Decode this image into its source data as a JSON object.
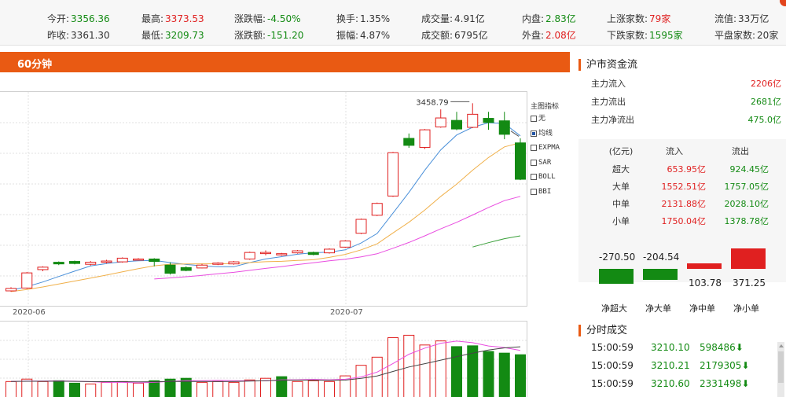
{
  "quote": {
    "row1": [
      {
        "label": "今开:",
        "value": "3356.36",
        "color": "#138a13"
      },
      {
        "label": "最高:",
        "value": "3373.53",
        "color": "#e02020"
      },
      {
        "label": "涨跌幅:",
        "value": "-4.50%",
        "color": "#138a13"
      },
      {
        "label": "换手:",
        "value": "1.35%",
        "color": "#333333"
      },
      {
        "label": "成交量:",
        "value": "4.91亿",
        "color": "#333333"
      },
      {
        "label": "内盘:",
        "value": "2.83亿",
        "color": "#138a13"
      },
      {
        "label": "上涨家数:",
        "value": "79家",
        "color": "#e02020"
      },
      {
        "label": "流值:",
        "value": "33万亿",
        "color": "#333333"
      }
    ],
    "row2": [
      {
        "label": "昨收:",
        "value": "3361.30",
        "color": "#333333"
      },
      {
        "label": "最低:",
        "value": "3209.73",
        "color": "#138a13"
      },
      {
        "label": "涨跌额:",
        "value": "-151.20",
        "color": "#138a13"
      },
      {
        "label": "振幅:",
        "value": "4.87%",
        "color": "#333333"
      },
      {
        "label": "成交额:",
        "value": "6795亿",
        "color": "#333333"
      },
      {
        "label": "外盘:",
        "value": "2.08亿",
        "color": "#e02020"
      },
      {
        "label": "下跌家数:",
        "value": "1595家",
        "color": "#138a13"
      },
      {
        "label": "平盘家数:",
        "value": "20家",
        "color": "#333333"
      }
    ]
  },
  "chart": {
    "period_tab": "60分钟",
    "x_labels": [
      "2020-06",
      "2020-07"
    ],
    "peak_label": "3458.79"
  },
  "indicators": {
    "title": "主图指标",
    "options": [
      {
        "label": "无",
        "checked": false
      },
      {
        "label": "均线",
        "checked": true
      },
      {
        "label": "EXPMA",
        "checked": false
      },
      {
        "label": "SAR",
        "checked": false
      },
      {
        "label": "BOLL",
        "checked": false
      },
      {
        "label": "BBI",
        "checked": false
      }
    ]
  },
  "fund_flow": {
    "title": "沪市资金流",
    "rows": [
      {
        "label": "主力流入",
        "value": "2206亿",
        "color": "#e02020"
      },
      {
        "label": "主力流出",
        "value": "2681亿",
        "color": "#138a13"
      },
      {
        "label": "主力净流出",
        "value": "475.0亿",
        "color": "#138a13"
      }
    ],
    "table": {
      "headers": [
        "(亿元)",
        "流入",
        "流出"
      ],
      "rows": [
        [
          "超大",
          "653.95亿",
          "924.45亿"
        ],
        [
          "大单",
          "1552.51亿",
          "1757.05亿"
        ],
        [
          "中单",
          "2131.88亿",
          "2028.10亿"
        ],
        [
          "小单",
          "1750.04亿",
          "1378.78亿"
        ]
      ]
    },
    "net": [
      {
        "label": "净超大",
        "value": "-270.50",
        "amount": -270.5
      },
      {
        "label": "净大单",
        "value": "-204.54",
        "amount": -204.54
      },
      {
        "label": "净中单",
        "value": "103.78",
        "amount": 103.78
      },
      {
        "label": "净小单",
        "value": "371.25",
        "amount": 371.25
      }
    ]
  },
  "trades": {
    "title": "分时成交",
    "rows": [
      {
        "time": "15:00:59",
        "price": "3210.10",
        "volume": "598486⬇"
      },
      {
        "time": "15:00:59",
        "price": "3210.21",
        "volume": "2179305⬇"
      },
      {
        "time": "15:00:59",
        "price": "3210.60",
        "volume": "2331498⬇"
      }
    ]
  },
  "colors": {
    "up": "#e02020",
    "down": "#138a13",
    "accent": "#e95a13"
  },
  "chart_data": {
    "type": "candlestick",
    "title": "",
    "xlabel": "",
    "ylabel": "",
    "x_labels": [
      "2020-06",
      "2020-07"
    ],
    "peak": 3458.79,
    "candles": [
      {
        "o": 3000,
        "c": 3006,
        "h": 3009,
        "l": 2998
      },
      {
        "o": 3007,
        "c": 3044,
        "h": 3046,
        "l": 3005
      },
      {
        "o": 3052,
        "c": 3058,
        "h": 3060,
        "l": 3048
      },
      {
        "o": 3070,
        "c": 3066,
        "h": 3072,
        "l": 3063
      },
      {
        "o": 3072,
        "c": 3067,
        "h": 3074,
        "l": 3065
      },
      {
        "o": 3065,
        "c": 3070,
        "h": 3073,
        "l": 3062
      },
      {
        "o": 3070,
        "c": 3073,
        "h": 3076,
        "l": 3067
      },
      {
        "o": 3071,
        "c": 3080,
        "h": 3082,
        "l": 3069
      },
      {
        "o": 3076,
        "c": 3078,
        "h": 3080,
        "l": 3074
      },
      {
        "o": 3078,
        "c": 3072,
        "h": 3080,
        "l": 3060
      },
      {
        "o": 3063,
        "c": 3043,
        "h": 3070,
        "l": 3040
      },
      {
        "o": 3057,
        "c": 3050,
        "h": 3060,
        "l": 3048
      },
      {
        "o": 3056,
        "c": 3063,
        "h": 3066,
        "l": 3055
      },
      {
        "o": 3065,
        "c": 3068,
        "h": 3070,
        "l": 3063
      },
      {
        "o": 3066,
        "c": 3071,
        "h": 3073,
        "l": 3064
      },
      {
        "o": 3078,
        "c": 3094,
        "h": 3096,
        "l": 3076
      },
      {
        "o": 3094,
        "c": 3094,
        "h": 3099,
        "l": 3087
      },
      {
        "o": 3088,
        "c": 3091,
        "h": 3093,
        "l": 3086
      },
      {
        "o": 3093,
        "c": 3098,
        "h": 3100,
        "l": 3091
      },
      {
        "o": 3094,
        "c": 3089,
        "h": 3096,
        "l": 3087
      },
      {
        "o": 3093,
        "c": 3102,
        "h": 3104,
        "l": 3091
      },
      {
        "o": 3107,
        "c": 3122,
        "h": 3124,
        "l": 3105
      },
      {
        "o": 3141,
        "c": 3175,
        "h": 3177,
        "l": 3139
      },
      {
        "o": 3185,
        "c": 3214,
        "h": 3216,
        "l": 3183
      },
      {
        "o": 3232,
        "c": 3338,
        "h": 3340,
        "l": 3230
      },
      {
        "o": 3373,
        "c": 3356,
        "h": 3385,
        "l": 3350
      },
      {
        "o": 3351,
        "c": 3394,
        "h": 3396,
        "l": 3347
      },
      {
        "o": 3401,
        "c": 3423,
        "h": 3444,
        "l": 3399
      },
      {
        "o": 3417,
        "c": 3396,
        "h": 3438,
        "l": 3393
      },
      {
        "o": 3400,
        "c": 3432,
        "h": 3459,
        "l": 3398
      },
      {
        "o": 3422,
        "c": 3412,
        "h": 3438,
        "l": 3394
      },
      {
        "o": 3416,
        "c": 3383,
        "h": 3438,
        "l": 3371
      },
      {
        "o": 3362,
        "c": 3273,
        "h": 3373,
        "l": 3271
      }
    ],
    "volume": [
      {
        "v": 2.0,
        "up": true
      },
      {
        "v": 2.3,
        "up": true
      },
      {
        "v": 2.0,
        "up": true
      },
      {
        "v": 2.1,
        "up": false
      },
      {
        "v": 1.8,
        "up": false
      },
      {
        "v": 1.7,
        "up": true
      },
      {
        "v": 1.9,
        "up": true
      },
      {
        "v": 2.0,
        "up": true
      },
      {
        "v": 1.8,
        "up": true
      },
      {
        "v": 2.1,
        "up": false
      },
      {
        "v": 2.3,
        "up": false
      },
      {
        "v": 2.4,
        "up": false
      },
      {
        "v": 1.9,
        "up": true
      },
      {
        "v": 2.0,
        "up": true
      },
      {
        "v": 1.9,
        "up": true
      },
      {
        "v": 2.2,
        "up": true
      },
      {
        "v": 2.4,
        "up": true
      },
      {
        "v": 2.6,
        "up": false
      },
      {
        "v": 2.0,
        "up": true
      },
      {
        "v": 2.1,
        "up": true
      },
      {
        "v": 2.0,
        "up": true
      },
      {
        "v": 2.7,
        "up": true
      },
      {
        "v": 4.0,
        "up": true
      },
      {
        "v": 5.0,
        "up": true
      },
      {
        "v": 7.4,
        "up": true
      },
      {
        "v": 7.7,
        "up": true
      },
      {
        "v": 6.5,
        "up": true
      },
      {
        "v": 7.0,
        "up": true
      },
      {
        "v": 6.3,
        "up": false
      },
      {
        "v": 6.4,
        "up": false
      },
      {
        "v": 5.7,
        "up": false
      },
      {
        "v": 5.5,
        "up": false
      },
      {
        "v": 5.3,
        "up": false
      }
    ]
  }
}
